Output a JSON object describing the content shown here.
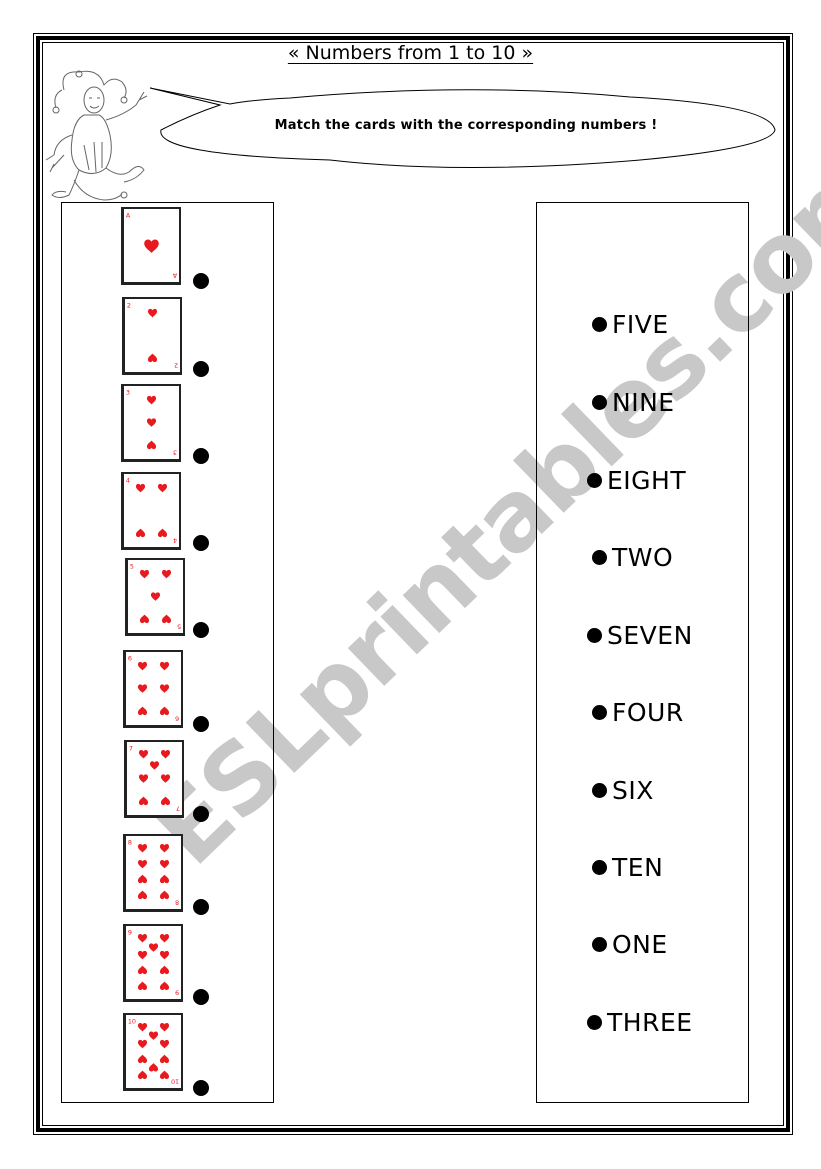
{
  "worksheet": {
    "title": "« Numbers from 1 to 10 »",
    "instruction": "Match the cards with the corresponding numbers !",
    "watermark": "ESLprintables.com",
    "heart_color": "#e8191f"
  },
  "cards": [
    {
      "rank": "A",
      "value": 1,
      "suit": "hearts"
    },
    {
      "rank": "2",
      "value": 2,
      "suit": "hearts"
    },
    {
      "rank": "3",
      "value": 3,
      "suit": "hearts"
    },
    {
      "rank": "4",
      "value": 4,
      "suit": "hearts"
    },
    {
      "rank": "5",
      "value": 5,
      "suit": "hearts"
    },
    {
      "rank": "6",
      "value": 6,
      "suit": "hearts"
    },
    {
      "rank": "7",
      "value": 7,
      "suit": "hearts"
    },
    {
      "rank": "8",
      "value": 8,
      "suit": "hearts"
    },
    {
      "rank": "9",
      "value": 9,
      "suit": "hearts"
    },
    {
      "rank": "10",
      "value": 10,
      "suit": "hearts"
    }
  ],
  "words": [
    {
      "label": "FIVE"
    },
    {
      "label": "NINE"
    },
    {
      "label": "EIGHT"
    },
    {
      "label": "TWO"
    },
    {
      "label": "SEVEN"
    },
    {
      "label": "FOUR"
    },
    {
      "label": "SIX"
    },
    {
      "label": "TEN"
    },
    {
      "label": "ONE"
    },
    {
      "label": "THREE"
    }
  ]
}
